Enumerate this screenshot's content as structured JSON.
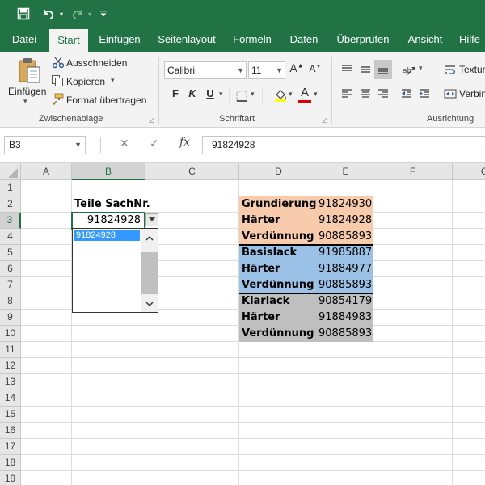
{
  "colors": {
    "brand": "#217346",
    "orange_fill": "#f8cbad",
    "blue_fill": "#9bc2e6",
    "gray_fill": "#bfbfbf",
    "list_highlight": "#3399ff"
  },
  "quick_access": {
    "save_icon": "save-icon",
    "undo_icon": "undo-icon",
    "redo_icon": "redo-icon",
    "customize_icon": "customize-qat-icon"
  },
  "tabs": [
    {
      "label": "Datei"
    },
    {
      "label": "Start"
    },
    {
      "label": "Einfügen"
    },
    {
      "label": "Seitenlayout"
    },
    {
      "label": "Formeln"
    },
    {
      "label": "Daten"
    },
    {
      "label": "Überprüfen"
    },
    {
      "label": "Ansicht"
    },
    {
      "label": "Hilfe"
    }
  ],
  "ribbon": {
    "clipboard": {
      "paste_label": "Einfügen",
      "cut_label": "Ausschneiden",
      "copy_label": "Kopieren",
      "format_painter_label": "Format übertragen",
      "group_label": "Zwischenablage"
    },
    "font": {
      "font_name": "Calibri",
      "font_size": "11",
      "grow_label": "A",
      "shrink_label": "A",
      "bold_label": "F",
      "italic_label": "K",
      "underline_label": "U",
      "font_color_label": "A",
      "group_label": "Schriftart"
    },
    "alignment": {
      "wrap_label": "Textum",
      "merge_label": "Verbin",
      "group_label": "Ausrichtung"
    }
  },
  "formula_bar": {
    "name_box": "B3",
    "fx_label": "fx",
    "formula": "91824928"
  },
  "sheet": {
    "columns": [
      "A",
      "B",
      "C",
      "D",
      "E",
      "F",
      "G"
    ],
    "rows": [
      "1",
      "2",
      "3",
      "4",
      "5",
      "6",
      "7",
      "8",
      "9",
      "10",
      "11",
      "12",
      "13",
      "14",
      "15",
      "16",
      "17",
      "18",
      "19"
    ],
    "selected_column": "B",
    "selected_row": "3",
    "header_label": "Teile SachNr.",
    "active_cell_value": "91824928",
    "table": [
      {
        "name": "Grundierung",
        "number": "91824930",
        "group": "orange"
      },
      {
        "name": "Härter",
        "number": "91824928",
        "group": "orange"
      },
      {
        "name": "Verdünnung",
        "number": "90885893",
        "group": "orange"
      },
      {
        "name": "Basislack",
        "number": "91985887",
        "group": "blue"
      },
      {
        "name": "Härter",
        "number": "91884977",
        "group": "blue"
      },
      {
        "name": "Verdünnung",
        "number": "90885893",
        "group": "blue"
      },
      {
        "name": "Klarlack",
        "number": "90854179",
        "group": "gray"
      },
      {
        "name": "Härter",
        "number": "91884983",
        "group": "gray"
      },
      {
        "name": "Verdünnung",
        "number": "90885893",
        "group": "gray"
      }
    ],
    "dropdown_items": [
      "91824928"
    ]
  }
}
